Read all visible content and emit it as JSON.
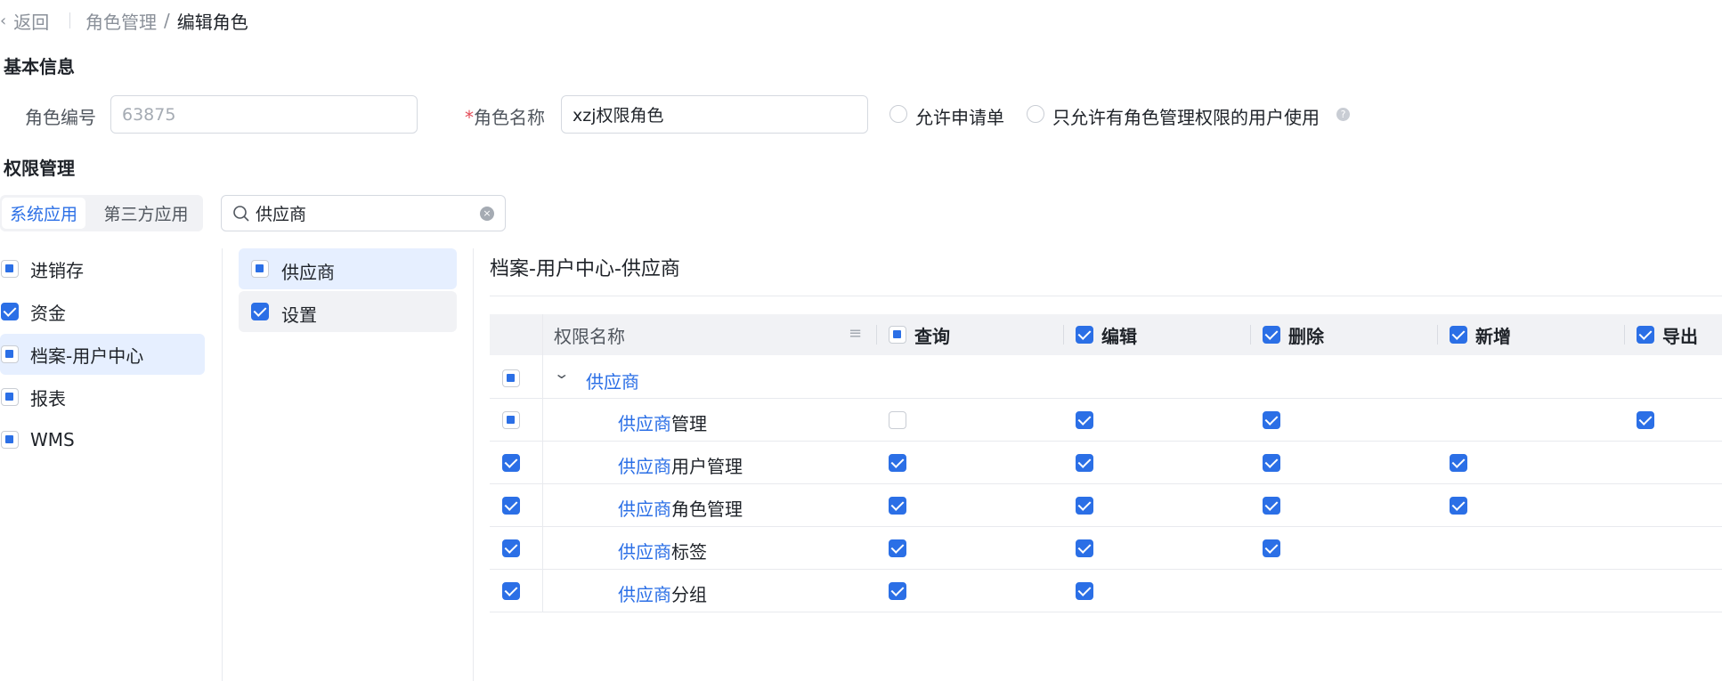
{
  "topbar": {
    "back": "返回",
    "crumb1": "角色管理",
    "sep": "/",
    "crumb2": "编辑角色"
  },
  "basic": {
    "title": "基本信息",
    "role_id_label": "角色编号",
    "role_id_placeholder": "63875",
    "role_name_required": "*",
    "role_name_label": "角色名称",
    "role_name_value": "xzj权限角色",
    "allow_apply": "允许申请单",
    "only_admin": "只允许有角色管理权限的用户使用"
  },
  "perm": {
    "title": "权限管理",
    "tabs": [
      "系统应用",
      "第三方应用"
    ],
    "search_value": "供应商"
  },
  "apps": [
    {
      "label": "进销存",
      "state": "partial"
    },
    {
      "label": "资金",
      "state": "checked"
    },
    {
      "label": "档案-用户中心",
      "state": "partial"
    },
    {
      "label": "报表",
      "state": "partial"
    },
    {
      "label": "WMS",
      "state": "partial"
    }
  ],
  "modules": [
    {
      "label": "供应商",
      "state": "partial"
    },
    {
      "label": "设置",
      "state": "checked"
    }
  ],
  "detail_title": "档案-用户中心-供应商",
  "table": {
    "name_header": "权限名称",
    "columns": [
      "查询",
      "编辑",
      "删除",
      "新增",
      "导出"
    ],
    "group": {
      "label": "供应商"
    },
    "rows": [
      {
        "highlight": "供应商",
        "rest": "管理",
        "row_state": "partial",
        "cells": [
          "unchecked",
          "checked",
          "checked",
          "none",
          "checked"
        ]
      },
      {
        "highlight": "供应商",
        "rest": "用户管理",
        "row_state": "checked",
        "cells": [
          "checked",
          "checked",
          "checked",
          "checked",
          "none"
        ]
      },
      {
        "highlight": "供应商",
        "rest": "角色管理",
        "row_state": "checked",
        "cells": [
          "checked",
          "checked",
          "checked",
          "checked",
          "none"
        ]
      },
      {
        "highlight": "供应商",
        "rest": "标签",
        "row_state": "checked",
        "cells": [
          "checked",
          "checked",
          "checked",
          "none",
          "none"
        ]
      },
      {
        "highlight": "供应商",
        "rest": "分组",
        "row_state": "checked",
        "cells": [
          "checked",
          "checked",
          "none",
          "none",
          "none"
        ]
      }
    ]
  },
  "colors": {
    "accent": "#2b6fe6",
    "active_bg": "#e6efff"
  }
}
